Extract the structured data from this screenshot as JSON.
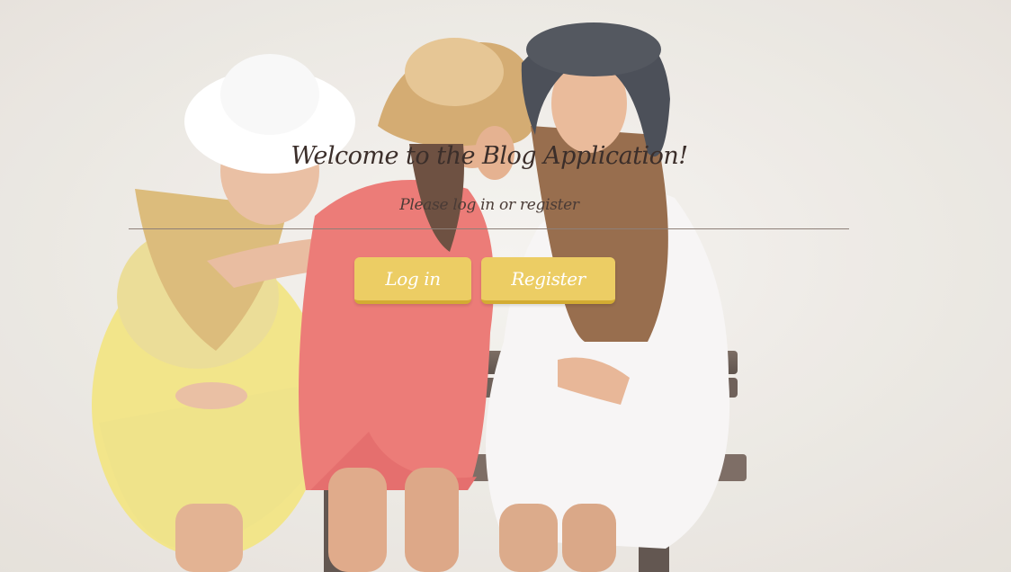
{
  "hero": {
    "image_description": "",
    "accent_color": "#eccd64",
    "accent_border": "#d3ac32"
  },
  "welcome": {
    "title": "Welcome to the Blog Application!",
    "subtitle": "Please log in or register"
  },
  "actions": {
    "login_label": "Log in",
    "register_label": "Register"
  }
}
